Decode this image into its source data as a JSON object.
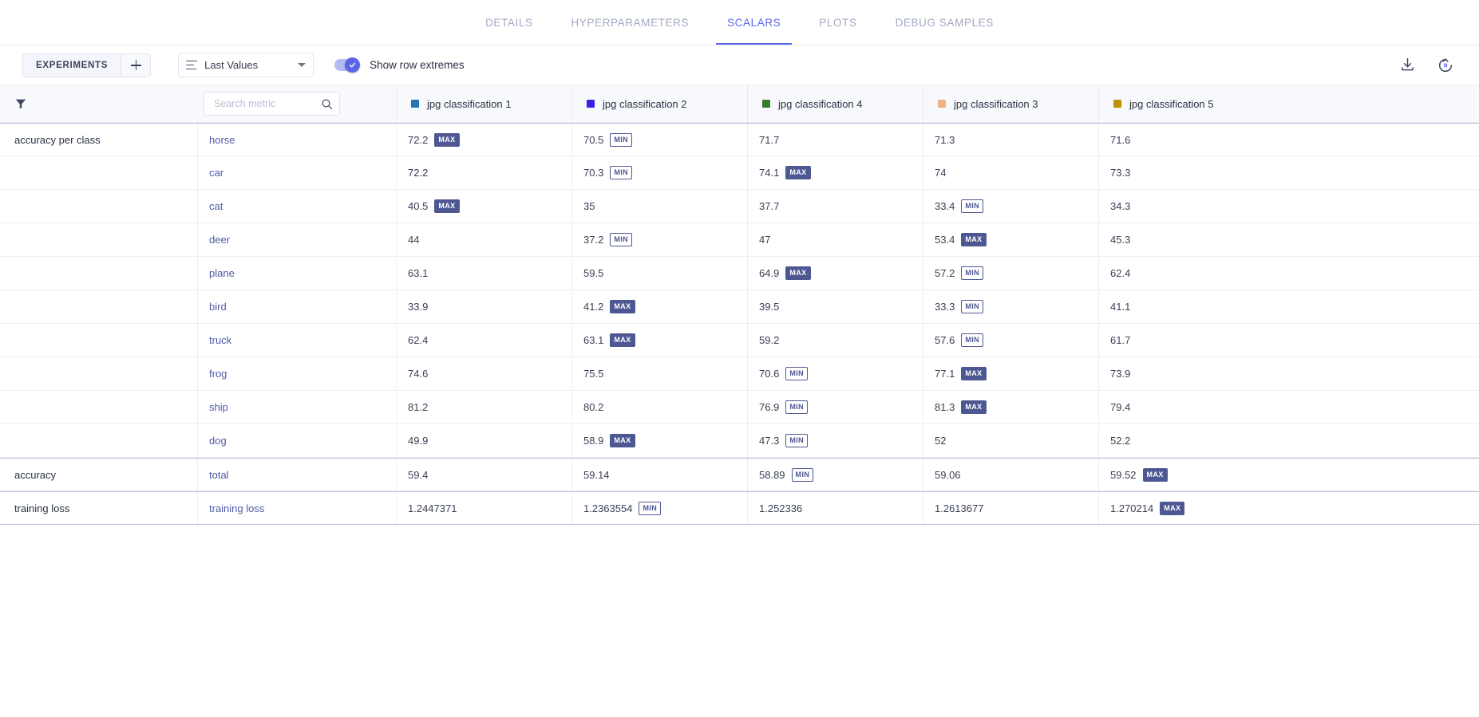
{
  "tabs": [
    {
      "label": "DETAILS",
      "active": false
    },
    {
      "label": "HYPERPARAMETERS",
      "active": false
    },
    {
      "label": "SCALARS",
      "active": true
    },
    {
      "label": "PLOTS",
      "active": false
    },
    {
      "label": "DEBUG SAMPLES",
      "active": false
    }
  ],
  "toolbar": {
    "experiments_label": "EXPERIMENTS",
    "add_label": "+",
    "select_value": "Last Values",
    "toggle_label": "Show row extremes",
    "toggle_on": true,
    "download_icon": "download-icon",
    "refresh_icon": "refresh-pause-icon"
  },
  "search": {
    "placeholder": "Search metric",
    "value": "",
    "filter_icon": "filter-icon",
    "search_icon": "search-icon"
  },
  "colors": {
    "accent": "#5a66e8",
    "badge_max_bg": "#4d5892",
    "badge_min_text": "#4d5892",
    "header_bg": "#f8f9fc",
    "variant_text": "#4f5ba8"
  },
  "columns": [
    {
      "label": "jpg classification 1",
      "color": "#1f77b4"
    },
    {
      "label": "jpg classification 2",
      "color": "#3a21e8"
    },
    {
      "label": "jpg classification 4",
      "color": "#3a7a2b"
    },
    {
      "label": "jpg classification 3",
      "color": "#f0b183"
    },
    {
      "label": "jpg classification 5",
      "color": "#bf9000"
    }
  ],
  "rows": [
    {
      "metric": "accuracy per class",
      "variant": "horse",
      "group_start": true,
      "values": [
        {
          "v": "72.2",
          "b": "MAX"
        },
        {
          "v": "70.5",
          "b": "MIN"
        },
        {
          "v": "71.7",
          "b": ""
        },
        {
          "v": "71.3",
          "b": ""
        },
        {
          "v": "71.6",
          "b": ""
        }
      ]
    },
    {
      "metric": "",
      "variant": "car",
      "group_start": false,
      "values": [
        {
          "v": "72.2",
          "b": ""
        },
        {
          "v": "70.3",
          "b": "MIN"
        },
        {
          "v": "74.1",
          "b": "MAX"
        },
        {
          "v": "74",
          "b": ""
        },
        {
          "v": "73.3",
          "b": ""
        }
      ]
    },
    {
      "metric": "",
      "variant": "cat",
      "group_start": false,
      "values": [
        {
          "v": "40.5",
          "b": "MAX"
        },
        {
          "v": "35",
          "b": ""
        },
        {
          "v": "37.7",
          "b": ""
        },
        {
          "v": "33.4",
          "b": "MIN"
        },
        {
          "v": "34.3",
          "b": ""
        }
      ]
    },
    {
      "metric": "",
      "variant": "deer",
      "group_start": false,
      "values": [
        {
          "v": "44",
          "b": ""
        },
        {
          "v": "37.2",
          "b": "MIN"
        },
        {
          "v": "47",
          "b": ""
        },
        {
          "v": "53.4",
          "b": "MAX"
        },
        {
          "v": "45.3",
          "b": ""
        }
      ]
    },
    {
      "metric": "",
      "variant": "plane",
      "group_start": false,
      "values": [
        {
          "v": "63.1",
          "b": ""
        },
        {
          "v": "59.5",
          "b": ""
        },
        {
          "v": "64.9",
          "b": "MAX"
        },
        {
          "v": "57.2",
          "b": "MIN"
        },
        {
          "v": "62.4",
          "b": ""
        }
      ]
    },
    {
      "metric": "",
      "variant": "bird",
      "group_start": false,
      "values": [
        {
          "v": "33.9",
          "b": ""
        },
        {
          "v": "41.2",
          "b": "MAX"
        },
        {
          "v": "39.5",
          "b": ""
        },
        {
          "v": "33.3",
          "b": "MIN"
        },
        {
          "v": "41.1",
          "b": ""
        }
      ]
    },
    {
      "metric": "",
      "variant": "truck",
      "group_start": false,
      "values": [
        {
          "v": "62.4",
          "b": ""
        },
        {
          "v": "63.1",
          "b": "MAX"
        },
        {
          "v": "59.2",
          "b": ""
        },
        {
          "v": "57.6",
          "b": "MIN"
        },
        {
          "v": "61.7",
          "b": ""
        }
      ]
    },
    {
      "metric": "",
      "variant": "frog",
      "group_start": false,
      "values": [
        {
          "v": "74.6",
          "b": ""
        },
        {
          "v": "75.5",
          "b": ""
        },
        {
          "v": "70.6",
          "b": "MIN"
        },
        {
          "v": "77.1",
          "b": "MAX"
        },
        {
          "v": "73.9",
          "b": ""
        }
      ]
    },
    {
      "metric": "",
      "variant": "ship",
      "group_start": false,
      "values": [
        {
          "v": "81.2",
          "b": ""
        },
        {
          "v": "80.2",
          "b": ""
        },
        {
          "v": "76.9",
          "b": "MIN"
        },
        {
          "v": "81.3",
          "b": "MAX"
        },
        {
          "v": "79.4",
          "b": ""
        }
      ]
    },
    {
      "metric": "",
      "variant": "dog",
      "group_start": false,
      "values": [
        {
          "v": "49.9",
          "b": ""
        },
        {
          "v": "58.9",
          "b": "MAX"
        },
        {
          "v": "47.3",
          "b": "MIN"
        },
        {
          "v": "52",
          "b": ""
        },
        {
          "v": "52.2",
          "b": ""
        }
      ]
    },
    {
      "metric": "accuracy",
      "variant": "total",
      "group_start": true,
      "values": [
        {
          "v": "59.4",
          "b": ""
        },
        {
          "v": "59.14",
          "b": ""
        },
        {
          "v": "58.89",
          "b": "MIN"
        },
        {
          "v": "59.06",
          "b": ""
        },
        {
          "v": "59.52",
          "b": "MAX"
        }
      ]
    },
    {
      "metric": "training loss",
      "variant": "training loss",
      "group_start": true,
      "last": true,
      "values": [
        {
          "v": "1.2447371",
          "b": ""
        },
        {
          "v": "1.2363554",
          "b": "MIN"
        },
        {
          "v": "1.252336",
          "b": ""
        },
        {
          "v": "1.2613677",
          "b": ""
        },
        {
          "v": "1.270214",
          "b": "MAX"
        }
      ]
    }
  ]
}
